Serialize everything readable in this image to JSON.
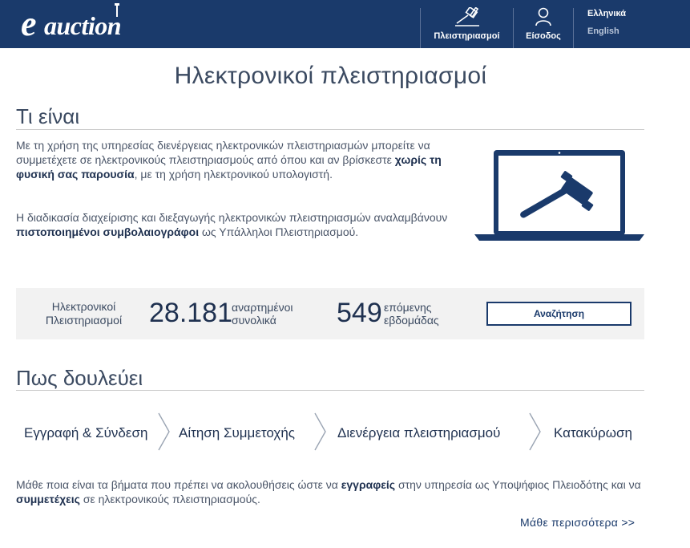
{
  "header": {
    "logo": {
      "e": "e",
      "rest": "auction"
    },
    "nav": {
      "auctions_label": "Πλειστηριασμοί",
      "login_label": "Είσοδος"
    },
    "languages": {
      "greek": "Ελληνικά",
      "english": "English"
    }
  },
  "page_title": "Ηλεκτρονικοί πλειστηριασμοί",
  "what_is": {
    "heading": "Τι είναι",
    "p1_a": "Με τη χρήση της υπηρεσίας διενέργειας ηλεκτρονικών πλειστηριασμών μπορείτε να συμμετέχετε σε ηλεκτρονικούς πλειστηριασμούς από όπου και αν βρίσκεστε ",
    "p1_b": "χωρίς τη φυσική σας παρουσία",
    "p1_c": ", με τη χρήση ηλεκτρονικού υπολογιστή.",
    "p2_a": "Η διαδικασία διαχείρισης και διεξαγωγής ηλεκτρονικών πλειστηριασμών αναλαμβάνουν ",
    "p2_b": "πιστοποιημένοι συμβολαιογράφοι",
    "p2_c": " ως Υπάλληλοι Πλειστηριασμού."
  },
  "stats": {
    "label_line1": "Ηλεκτρονικοί",
    "label_line2": "Πλειστηριασμοί",
    "total_number": "28.181",
    "total_line1": "αναρτημένοι",
    "total_line2": "συνολικά",
    "next_number": "549",
    "next_line1": "επόμενης",
    "next_line2": "εβδομάδας",
    "search_label": "Αναζήτηση"
  },
  "how": {
    "heading": "Πως δουλεύει",
    "steps": [
      "Εγγραφή & Σύνδεση",
      "Αίτηση Συμμετοχής",
      "Διενέργεια πλειστηριασμού",
      "Κατακύρωση"
    ],
    "p_a": "Μάθε ποια είναι τα βήματα που πρέπει να ακολουθήσεις ώστε να ",
    "p_b": "εγγραφείς",
    "p_c": " στην υπηρεσία ως Υποψήφιος Πλειοδότης και να ",
    "p_d": "συμμετέχεις",
    "p_e": " σε ηλεκτρονικούς πλειστηριασμούς.",
    "learn_more": "Μάθε περισσότερα >>"
  },
  "colors": {
    "brand_navy": "#1a3a6b",
    "text_dark": "#1f3150",
    "panel_gray": "#f2f2f2"
  },
  "icons": [
    "gavel-icon",
    "user-icon",
    "laptop-gavel-illustration",
    "chevron-right-icon"
  ]
}
